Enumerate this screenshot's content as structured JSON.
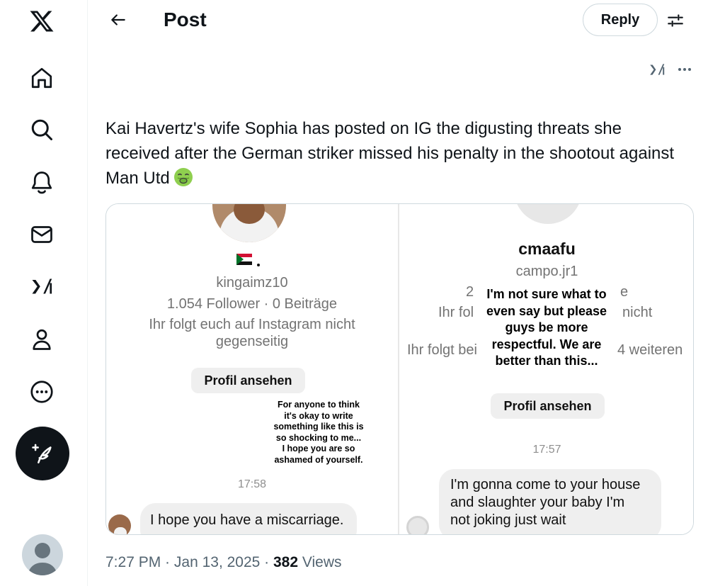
{
  "header": {
    "title": "Post",
    "reply_label": "Reply"
  },
  "post": {
    "text": "Kai Havertz's wife Sophia has posted on IG the digusting threats she received after the German striker missed his penalty in the shootout against Man Utd",
    "emoji": "nauseated-face"
  },
  "media": {
    "left": {
      "username": "kingaimz10",
      "stats": "1.054 Follower · 0 Beiträge",
      "follow_line1": "Ihr folgt euch auf Instagram nicht",
      "follow_line2": "gegenseitig",
      "button": "Profil ansehen",
      "overlay": [
        "For anyone to think",
        "it's okay to write",
        "something like this is",
        "so shocking to me...",
        "I hope you are so",
        "ashamed of yourself."
      ],
      "time": "17:58",
      "message": "I hope you have a miscarriage."
    },
    "right": {
      "name": "cmaafu",
      "username": "campo.jr1",
      "frag_a": "2",
      "frag_b": "e",
      "frag_c": "Ihr fol",
      "frag_d": "nicht",
      "frag_e": "Ihr folgt bei",
      "frag_f": "4 weiteren",
      "overlay": [
        "I'm not sure what to",
        "even say but please",
        "guys be more",
        "respectful. We are",
        "better than this..."
      ],
      "button": "Profil ansehen",
      "time": "17:57",
      "message": [
        "I'm gonna come to your house",
        "and slaughter your baby I'm",
        "not joking just wait"
      ]
    }
  },
  "meta": {
    "time": "7:27 PM",
    "sep1": " · ",
    "date": "Jan 13, 2025",
    "sep2": " · ",
    "views_count": "382",
    "views_label": " Views"
  }
}
